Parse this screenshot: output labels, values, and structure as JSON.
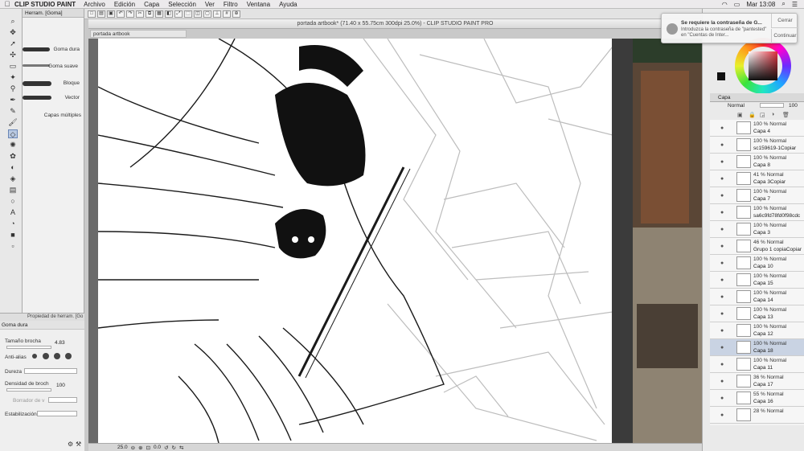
{
  "menubar": {
    "app_name": "CLIP STUDIO PAINT",
    "items": [
      "Archivo",
      "Edición",
      "Capa",
      "Selección",
      "Ver",
      "Filtro",
      "Ventana",
      "Ayuda"
    ],
    "clock": "Mar 13:08"
  },
  "window": {
    "title": "portada artbook* (71.40 x 55.75cm 300dpi 25.0%) - CLIP STUDIO PAINT PRO",
    "doc_tab": "portada artbook"
  },
  "subtool": {
    "header": "Herram. [Goma]",
    "brushes": [
      {
        "label": "Goma dura"
      },
      {
        "label": "Goma suave"
      },
      {
        "label": "Bloque"
      },
      {
        "label": "Vector"
      },
      {
        "label": "Capas múltiples"
      }
    ]
  },
  "tool_property": {
    "header": "Propiedad de herram. [Go",
    "tool_name": "Goma dura",
    "brush_size_label": "Tamaño brocha",
    "brush_size_value": "4.83",
    "antialias_label": "Anti-alias",
    "hardness_label": "Dureza",
    "density_label": "Densidad de broch",
    "density_value": "100",
    "vector_eraser_label": "Borrador de v",
    "stabilization_label": "Estabilización"
  },
  "status": {
    "zoom": "25.0",
    "angle": "0.0"
  },
  "notification": {
    "title": "Se requiere la contraseña de G...",
    "body": "Introduzca la contraseña de \"pantested\" en \"Cuentas de Inter...",
    "close_label": "Cerrar",
    "continue_label": "Continuar"
  },
  "layer_panel": {
    "tab_label": "Capa",
    "blend_mode": "Normal",
    "opacity": "100",
    "layers": [
      {
        "mode": "100 % Normal",
        "name": "Capa 4"
      },
      {
        "mode": "100 % Normal",
        "name": "sc159619-1Copiar"
      },
      {
        "mode": "100 % Normal",
        "name": "Capa 8"
      },
      {
        "mode": "41 % Normal",
        "name": "Capa 3Copiar"
      },
      {
        "mode": "100 % Normal",
        "name": "Capa 7"
      },
      {
        "mode": "100 % Normal",
        "name": "sa6c9fd78fd0f98cdc"
      },
      {
        "mode": "100 % Normal",
        "name": "Capa 3"
      },
      {
        "mode": "46 % Normal",
        "name": "Grupo 1 copiaCopiar"
      },
      {
        "mode": "100 % Normal",
        "name": "Capa 10"
      },
      {
        "mode": "100 % Normal",
        "name": "Capa 15"
      },
      {
        "mode": "100 % Normal",
        "name": "Capa 14"
      },
      {
        "mode": "100 % Normal",
        "name": "Capa 13"
      },
      {
        "mode": "100 % Normal",
        "name": "Capa 12"
      },
      {
        "mode": "100 % Normal",
        "name": "Capa 18"
      },
      {
        "mode": "100 % Normal",
        "name": "Capa 11"
      },
      {
        "mode": "36 % Normal",
        "name": "Capa 17"
      },
      {
        "mode": "55 % Normal",
        "name": "Capa 16"
      },
      {
        "mode": "28 % Normal",
        "name": ""
      }
    ]
  },
  "colors": {
    "accent_selection": "#c9d3e3",
    "main_color": "#111111"
  }
}
